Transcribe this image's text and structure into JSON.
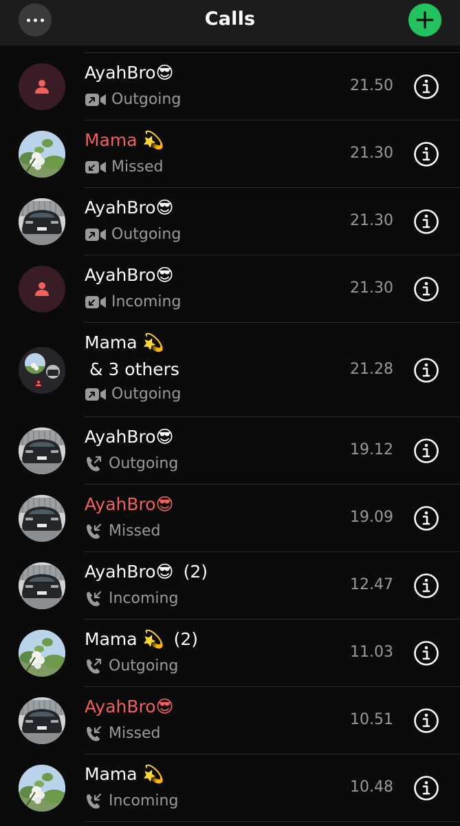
{
  "header": {
    "title": "Calls",
    "more_icon": "ellipsis-icon",
    "add_icon": "plus-icon",
    "accent": "#22c35e"
  },
  "colors": {
    "missed": "#f0605c",
    "secondary_text": "#9a9a9a"
  },
  "calls": [
    {
      "name": "AyahBro😎",
      "count": "",
      "type_label": "Outgoing",
      "media": "video",
      "direction": "outgoing",
      "missed": false,
      "time": "21.50",
      "avatar": "default-contact-icon"
    },
    {
      "name": "Mama 💫",
      "count": "",
      "type_label": "Missed",
      "media": "video",
      "direction": "incoming",
      "missed": true,
      "time": "21.30",
      "avatar": "flower-photo"
    },
    {
      "name": "AyahBro😎",
      "count": "",
      "type_label": "Outgoing",
      "media": "video",
      "direction": "outgoing",
      "missed": false,
      "time": "21.30",
      "avatar": "car-photo"
    },
    {
      "name": "AyahBro😎",
      "count": "",
      "type_label": "Incoming",
      "media": "video",
      "direction": "incoming",
      "missed": false,
      "time": "21.30",
      "avatar": "default-contact-icon"
    },
    {
      "name": "Mama 💫",
      "name_line2": "& 3 others",
      "count": "",
      "type_label": "Outgoing",
      "media": "video",
      "direction": "outgoing",
      "missed": false,
      "time": "21.28",
      "avatar": "group-avatar"
    },
    {
      "name": "AyahBro😎",
      "count": "",
      "type_label": "Outgoing",
      "media": "voice",
      "direction": "outgoing",
      "missed": false,
      "time": "19.12",
      "avatar": "car-photo"
    },
    {
      "name": "AyahBro😎",
      "count": "",
      "type_label": "Missed",
      "media": "voice",
      "direction": "incoming",
      "missed": true,
      "time": "19.09",
      "avatar": "car-photo"
    },
    {
      "name": "AyahBro😎",
      "count": "(2)",
      "type_label": "Incoming",
      "media": "voice",
      "direction": "incoming",
      "missed": false,
      "time": "12.47",
      "avatar": "car-photo"
    },
    {
      "name": "Mama 💫",
      "count": "(2)",
      "type_label": "Outgoing",
      "media": "voice",
      "direction": "outgoing",
      "missed": false,
      "time": "11.03",
      "avatar": "flower-photo"
    },
    {
      "name": "AyahBro😎",
      "count": "",
      "type_label": "Missed",
      "media": "voice",
      "direction": "incoming",
      "missed": true,
      "time": "10.51",
      "avatar": "car-photo"
    },
    {
      "name": "Mama 💫",
      "count": "",
      "type_label": "Incoming",
      "media": "voice",
      "direction": "incoming",
      "missed": false,
      "time": "10.48",
      "avatar": "flower-photo"
    }
  ]
}
